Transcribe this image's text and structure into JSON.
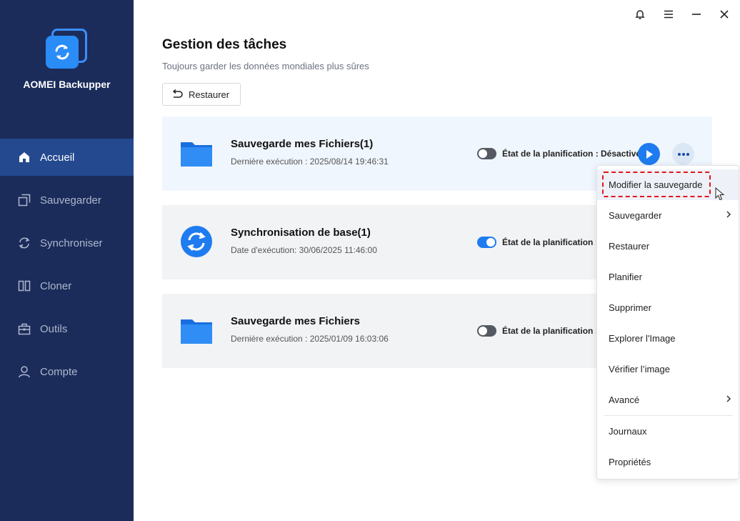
{
  "app": {
    "name": "AOMEI Backupper"
  },
  "sidebar": {
    "items": [
      {
        "label": "Accueil",
        "icon": "home-icon",
        "active": true
      },
      {
        "label": "Sauvegarder",
        "icon": "backup-icon",
        "active": false
      },
      {
        "label": "Synchroniser",
        "icon": "sync-icon",
        "active": false
      },
      {
        "label": "Cloner",
        "icon": "clone-icon",
        "active": false
      },
      {
        "label": "Outils",
        "icon": "tools-icon",
        "active": false
      },
      {
        "label": "Compte",
        "icon": "account-icon",
        "active": false
      }
    ]
  },
  "titlebar": {
    "icons": [
      "bell-icon",
      "menu-icon",
      "minimize-icon",
      "close-icon"
    ]
  },
  "main": {
    "title": "Gestion des tâches",
    "subtitle": "Toujours garder les données mondiales plus sûres",
    "restore_label": "Restaurer"
  },
  "tasks": [
    {
      "name": "Sauvegarde mes Fichiers(1)",
      "meta": "Dernière exécution : 2025/08/14 19:46:31",
      "schedule": "État de la planification : Désactivé",
      "schedule_on": false,
      "icon": "folder-icon"
    },
    {
      "name": "Synchronisation de base(1)",
      "meta": "Date d'exécution: 30/06/2025 11:46:00",
      "schedule": "État de la planification : A",
      "schedule_on": true,
      "icon": "sync-icon"
    },
    {
      "name": "Sauvegarde mes Fichiers",
      "meta": "Dernière exécution : 2025/01/09 16:03:06",
      "schedule": "État de la planification : D",
      "schedule_on": false,
      "icon": "folder-icon"
    }
  ],
  "context_menu": {
    "items": [
      {
        "label": "Modifier la sauvegarde",
        "submenu": false
      },
      {
        "label": "Sauvegarder",
        "submenu": true
      },
      {
        "label": "Restaurer",
        "submenu": false
      },
      {
        "label": "Planifier",
        "submenu": false
      },
      {
        "label": "Supprimer",
        "submenu": false
      },
      {
        "label": "Explorer l'Image",
        "submenu": false
      },
      {
        "label": "Vérifier l’image",
        "submenu": false
      },
      {
        "label": "Avancé",
        "submenu": true
      },
      {
        "label": "Journaux",
        "submenu": false
      },
      {
        "label": "Propriétés",
        "submenu": false
      }
    ]
  },
  "colors": {
    "sidebar_bg": "#1b2c5a",
    "sidebar_active": "#24498f",
    "accent": "#1e7cf0",
    "highlight_border": "#e2141c"
  }
}
